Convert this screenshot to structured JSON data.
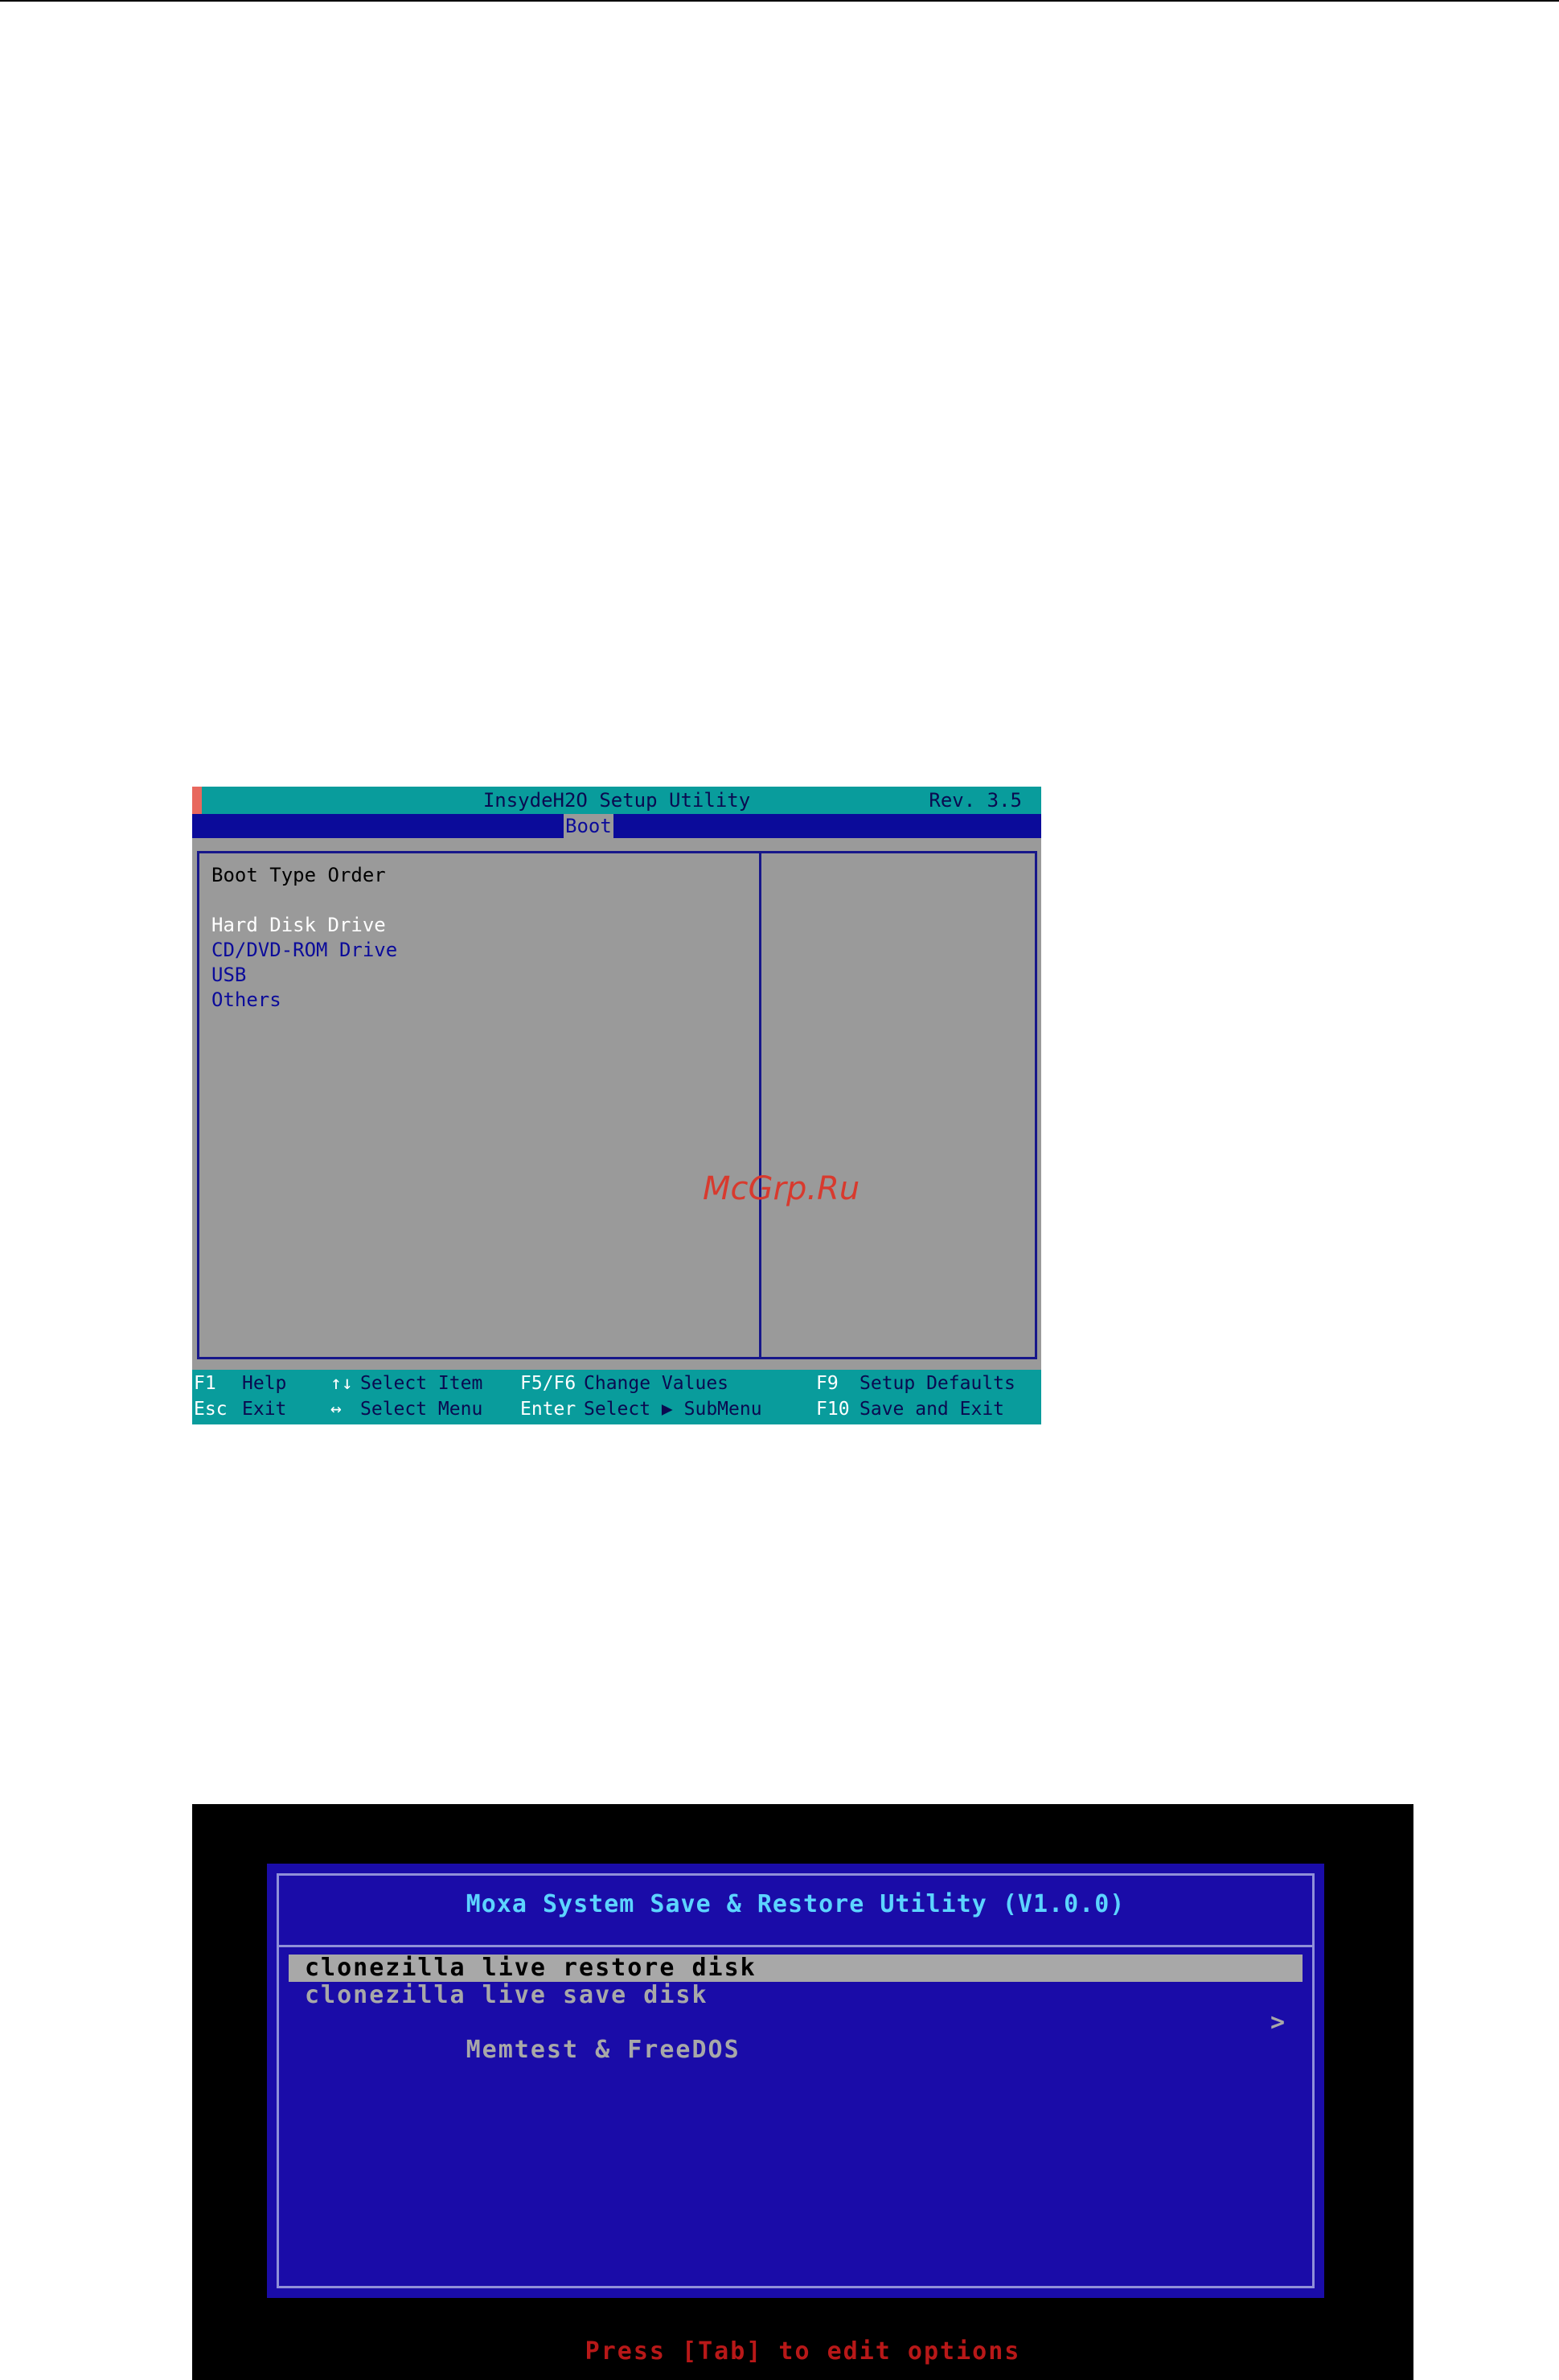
{
  "bios": {
    "title": "InsydeH2O Setup Utility",
    "revision": "Rev. 3.5",
    "active_tab": "Boot",
    "section_title": "Boot Type Order",
    "items": [
      "Hard Disk Drive",
      "CD/DVD-ROM Drive",
      "USB",
      "Others"
    ],
    "selected_item": "Hard Disk Drive",
    "footer": {
      "row1": [
        {
          "key": "F1",
          "desc": "Help"
        },
        {
          "key": "↑↓",
          "desc": "Select Item"
        },
        {
          "key": "F5/F6",
          "desc": "Change Values"
        },
        {
          "key": "F9",
          "desc": "Setup Defaults"
        }
      ],
      "row2": [
        {
          "key": "Esc",
          "desc": "Exit"
        },
        {
          "key": "↔",
          "desc": "Select Menu"
        },
        {
          "key": "Enter",
          "desc": "Select ▶ SubMenu"
        },
        {
          "key": "F10",
          "desc": "Save and Exit"
        }
      ]
    },
    "colors": {
      "title_bar": "#099c9c",
      "menu_bar": "#0b0b9a",
      "panel": "#9a9a9a"
    }
  },
  "boot_menu": {
    "title": "Moxa System Save & Restore Utility (V1.0.0)",
    "items": [
      "clonezilla live restore disk",
      "clonezilla live save disk",
      "Memtest & FreeDOS"
    ],
    "submenu_indicator": ">",
    "hint": "Press [Tab] to edit options",
    "colors": {
      "background": "#1a0ca8",
      "title": "#5cd4ff",
      "hint": "#b81818"
    }
  },
  "watermark": "McGrp.Ru"
}
